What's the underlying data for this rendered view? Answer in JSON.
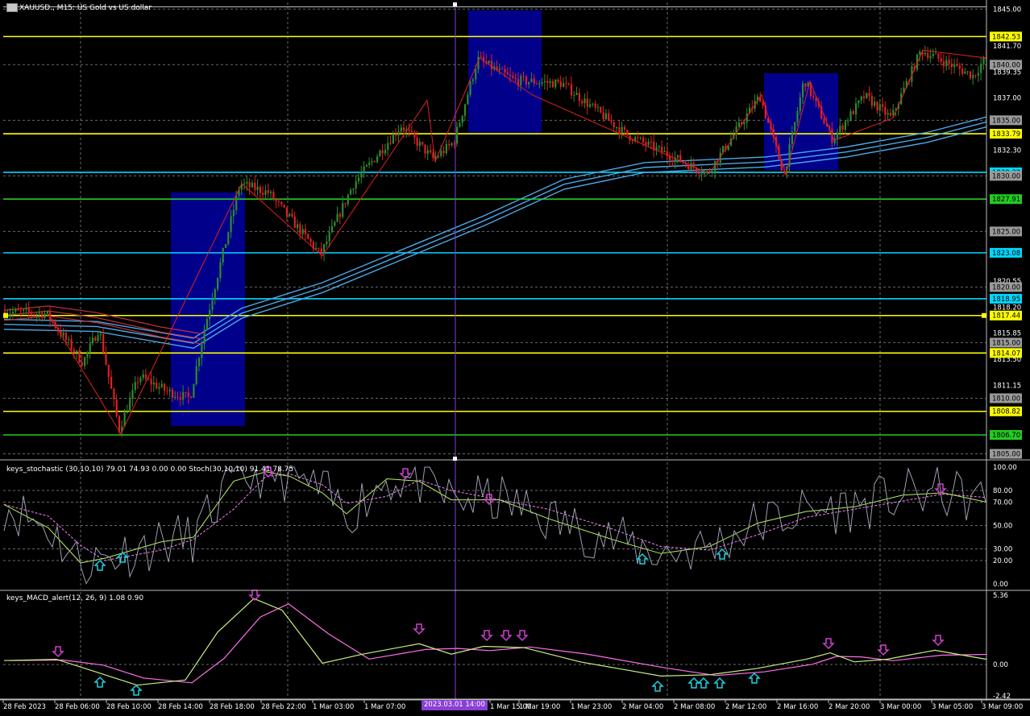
{
  "window": {
    "title": "XAUUSD., M15: US Gold vs US dollar"
  },
  "colors": {
    "background": "#000000",
    "bull": "#2e8b2e",
    "bear": "#e02020",
    "yellow_level": "#ffff00",
    "cyan_level": "#00d8ff",
    "green_level": "#22cc22",
    "box": "#00008b",
    "ma_blue": "#4aa8e8",
    "ma_red": "#c03040",
    "zigzag": "#e02020",
    "crosshair": "#8a3fd6"
  },
  "price_axis": {
    "labels": [
      "1845.00",
      "1841.70",
      "1839.35",
      "1837.00",
      "1835.00",
      "1832.30",
      "1830.00",
      "1827.91",
      "1825.00",
      "1823.08",
      "1820.55",
      "1818.20",
      "1815.85",
      "1813.50",
      "1811.15",
      "1808.82",
      "1805.00"
    ]
  },
  "price_tags": [
    {
      "value": "1842.53",
      "kind": "yellow"
    },
    {
      "value": "1840.00",
      "kind": "gray"
    },
    {
      "value": "1835.00",
      "kind": "gray"
    },
    {
      "value": "1833.79",
      "kind": "yellow"
    },
    {
      "value": "1830.32",
      "kind": "cyan"
    },
    {
      "value": "1830.00",
      "kind": "gray"
    },
    {
      "value": "1827.91",
      "kind": "green"
    },
    {
      "value": "1825.00",
      "kind": "gray"
    },
    {
      "value": "1823.08",
      "kind": "cyan"
    },
    {
      "value": "1820.00",
      "kind": "gray"
    },
    {
      "value": "1818.95",
      "kind": "cyan"
    },
    {
      "value": "1817.44",
      "kind": "yellow"
    },
    {
      "value": "1815.00",
      "kind": "gray"
    },
    {
      "value": "1814.07",
      "kind": "yellow"
    },
    {
      "value": "1810.00",
      "kind": "gray"
    },
    {
      "value": "1808.82",
      "kind": "yellow"
    },
    {
      "value": "1806.70",
      "kind": "green"
    },
    {
      "value": "1805.00",
      "kind": "gray"
    }
  ],
  "stochastic": {
    "label": "keys_stochastic (30,10,10) 79.01 74.93 0.00 0.00 Stoch(30,10,10) 91.41 78.75",
    "axis": [
      "100.00",
      "80.00",
      "70.00",
      "50.00",
      "30.00",
      "20.00",
      "0.00"
    ]
  },
  "macd": {
    "label": "keys_MACD_alert(12, 26, 9) 1.08 0.90",
    "axis": [
      "5.36",
      "0.00",
      "-2.42"
    ]
  },
  "time_axis": {
    "labels": [
      "28 Feb 2023",
      "28 Feb 06:00",
      "28 Feb 10:00",
      "28 Feb 14:00",
      "28 Feb 18:00",
      "28 Feb 22:00",
      "1 Mar 03:00",
      "1 Mar 07:00",
      "1 Mar 15:00",
      "1 Mar 19:00",
      "1 Mar 23:00",
      "2 Mar 04:00",
      "2 Mar 08:00",
      "2 Mar 12:00",
      "2 Mar 16:00",
      "2 Mar 20:00",
      "3 Mar 00:00",
      "3 Mar 05:00",
      "3 Mar 09:00"
    ],
    "crosshair": "2023.03.01 14:00"
  }
}
